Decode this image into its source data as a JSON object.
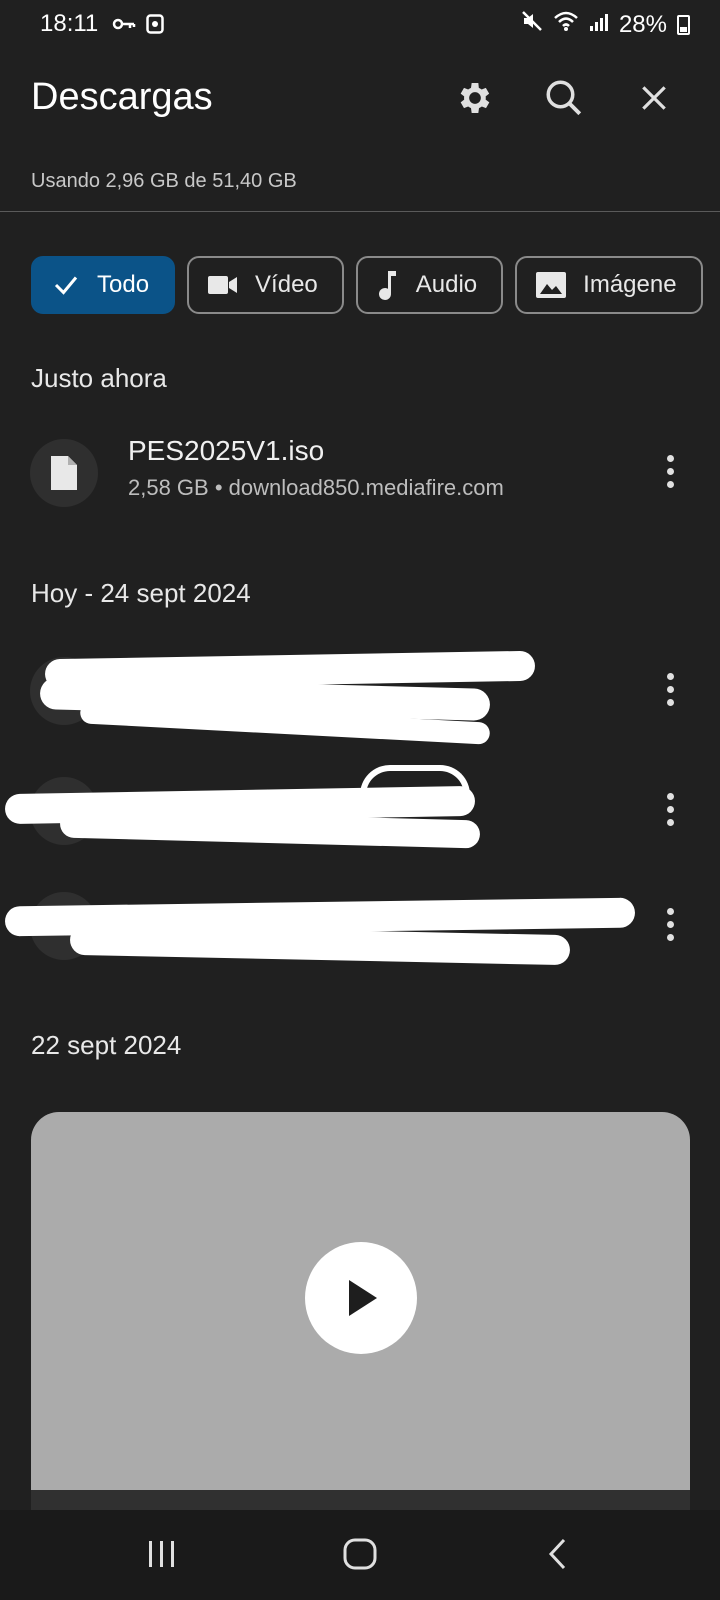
{
  "status_bar": {
    "time": "18:11",
    "battery": "28%",
    "icons": [
      "key-icon",
      "screen-record-icon",
      "mute-icon",
      "wifi-icon",
      "signal-icon",
      "battery-icon"
    ]
  },
  "header": {
    "title": "Descargas",
    "storage_usage": "Usando 2,96 GB de 51,40 GB",
    "icons": [
      "settings-icon",
      "search-icon",
      "close-icon"
    ]
  },
  "filters": [
    {
      "label": "Todo",
      "icon": "check-icon",
      "selected": true
    },
    {
      "label": "Vídeo",
      "icon": "video-icon",
      "selected": false
    },
    {
      "label": "Audio",
      "icon": "music-note-icon",
      "selected": false
    },
    {
      "label": "Imágene",
      "icon": "image-icon",
      "selected": false
    }
  ],
  "sections": [
    {
      "title": "Justo ahora",
      "items": [
        {
          "name": "PES2025V1.iso",
          "meta": "2,58 GB • download850.mediafire.com",
          "icon": "file-icon"
        }
      ]
    },
    {
      "title": "Hoy - 24 sept 2024",
      "items": [
        {
          "name": "",
          "meta": "",
          "icon": "file-icon",
          "redacted": true
        },
        {
          "name": "",
          "meta": "",
          "icon": "music-note-icon",
          "redacted": true
        },
        {
          "name": "",
          "meta": "",
          "icon": "music-note-icon",
          "redacted": true
        }
      ]
    },
    {
      "title": "22 sept 2024",
      "items": [
        {
          "type": "video-preview",
          "icon": "play-icon"
        }
      ]
    }
  ],
  "colors": {
    "background": "#202020",
    "chip_selected": "#0b5388",
    "video_placeholder": "#ababab"
  },
  "nav_bar": {
    "icons": [
      "recent-apps-icon",
      "home-icon",
      "back-icon"
    ]
  }
}
